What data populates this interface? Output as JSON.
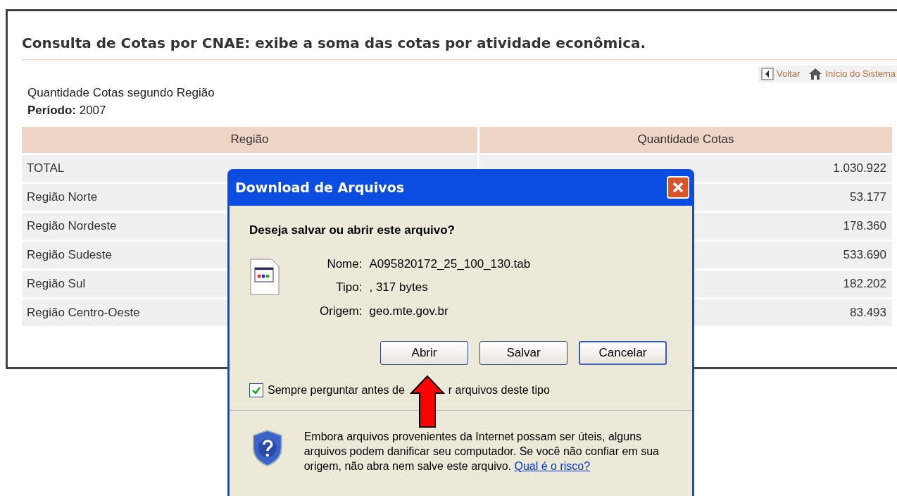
{
  "page": {
    "title": "Consulta de Cotas por CNAE: exibe a soma das cotas por atividade econômica.",
    "nav_links": [
      {
        "kind": "back",
        "label": "Voltar"
      },
      {
        "kind": "home",
        "label": "Início do Sistema"
      }
    ],
    "report_title": "Quantidade Cotas segundo Região",
    "period_label": "Período:",
    "period_value": "2007"
  },
  "table": {
    "columns": [
      "Região",
      "Quantidade Cotas"
    ],
    "rows": [
      {
        "region": "TOTAL",
        "quantity": "1.030.922"
      },
      {
        "region": "Região Norte",
        "quantity": "53.177"
      },
      {
        "region": "Região Nordeste",
        "quantity": "178.360"
      },
      {
        "region": "Região Sudeste",
        "quantity": "533.690"
      },
      {
        "region": "Região Sul",
        "quantity": "182.202"
      },
      {
        "region": "Região Centro-Oeste",
        "quantity": "83.493"
      }
    ]
  },
  "dialog": {
    "title": "Download de Arquivos",
    "question": "Deseja salvar ou abrir este arquivo?",
    "fields": [
      {
        "label": "Nome:",
        "value": "A095820172_25_100_130.tab"
      },
      {
        "label": "Tipo:",
        "value": ", 317 bytes"
      },
      {
        "label": "Origem:",
        "value": "geo.mte.gov.br"
      }
    ],
    "buttons": [
      {
        "label": "Abrir",
        "selected": false
      },
      {
        "label": "Salvar",
        "selected": false
      },
      {
        "label": "Cancelar",
        "selected": true
      }
    ],
    "checkbox": {
      "checked": true,
      "label_before": "Sempre perguntar antes de",
      "label_after": "r arquivos deste tipo"
    },
    "warning": "Embora arquivos provenientes da Internet possam ser úteis, alguns arquivos podem danificar seu computador. Se você não confiar em sua origem, não abra nem salve este arquivo.",
    "risk_link": "Qual é o risco?"
  }
}
